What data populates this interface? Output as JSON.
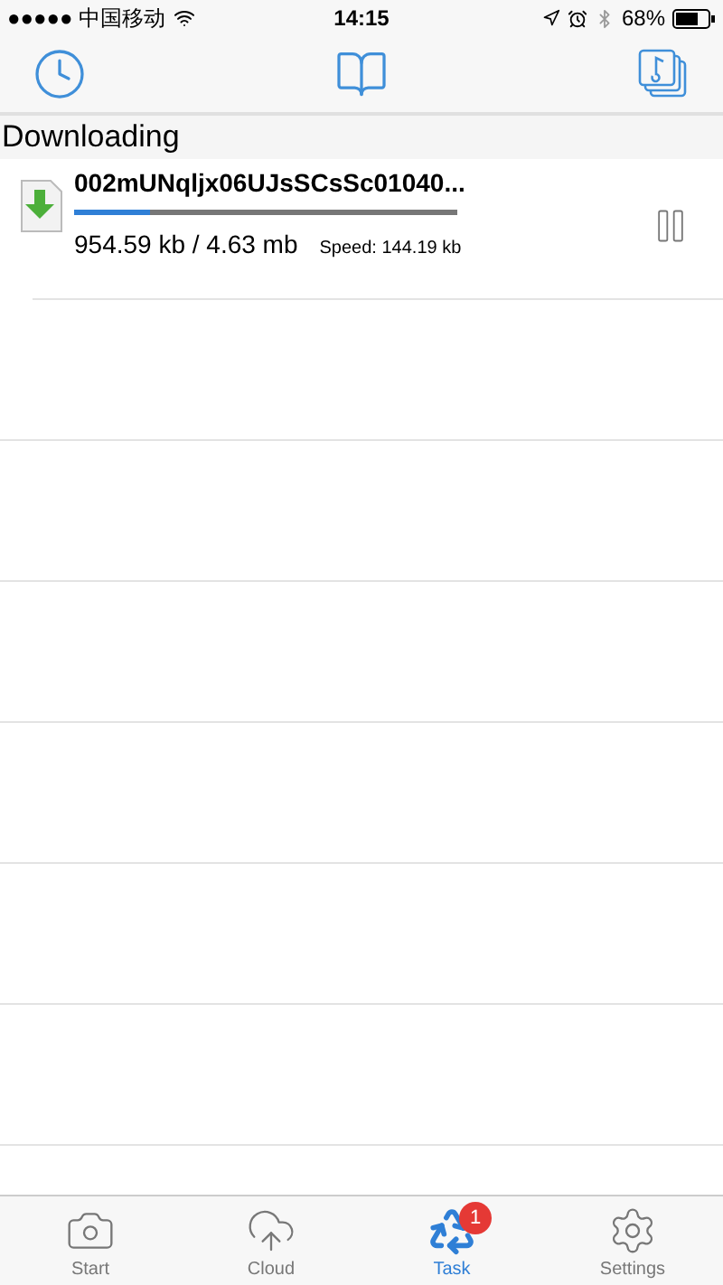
{
  "status_bar": {
    "carrier": "●●●●● 中国移动",
    "time": "14:15",
    "battery": "68%"
  },
  "section": {
    "title": "Downloading"
  },
  "downloads": [
    {
      "name": "002mUNqljx06UJsSCsSc01040...",
      "level": 0.2,
      "size": "954.59 kb / 4.63 mb",
      "speed": "Speed: 144.19 kb"
    }
  ],
  "tab_bar": [
    {
      "label": "Start",
      "selected": false
    },
    {
      "label": "Cloud",
      "selected": false
    },
    {
      "label": "Task",
      "selected": true,
      "badge": "1"
    },
    {
      "label": "Settings",
      "selected": false
    }
  ]
}
